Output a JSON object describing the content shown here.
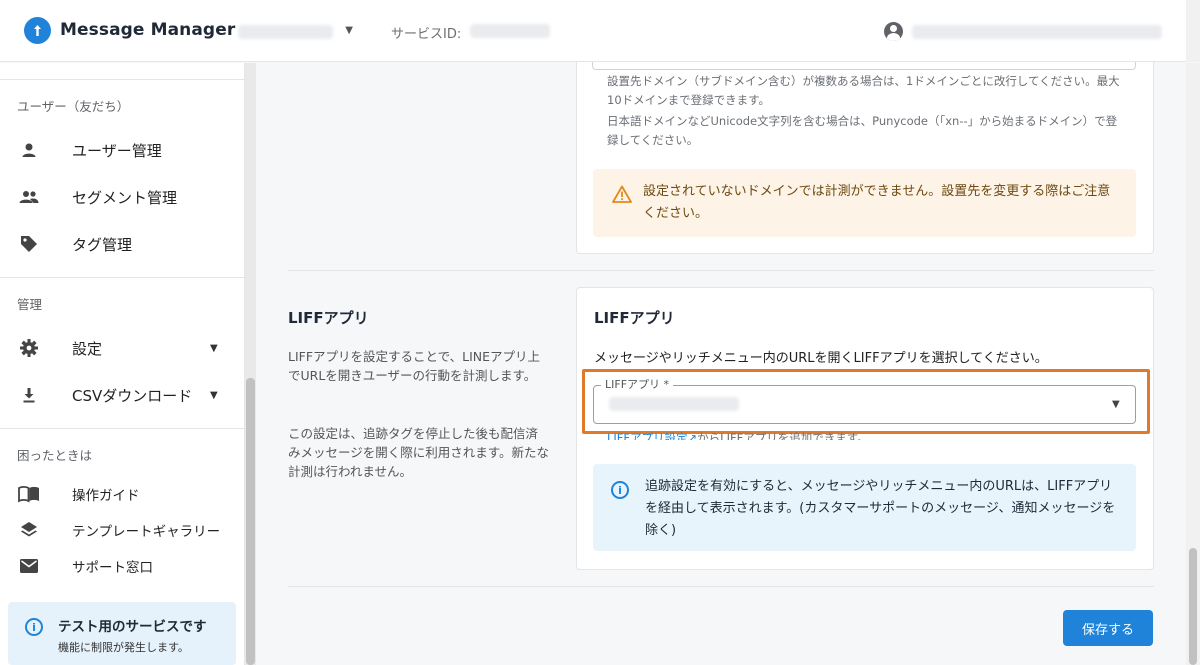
{
  "header": {
    "app_title": "Message Manager",
    "service_label": "サービスID:"
  },
  "sidebar": {
    "sections": [
      {
        "title": "ユーザー（友だち）",
        "items": [
          {
            "label": "ユーザー管理",
            "icon": "person-icon"
          },
          {
            "label": "セグメント管理",
            "icon": "group-icon"
          },
          {
            "label": "タグ管理",
            "icon": "tag-icon"
          }
        ]
      },
      {
        "title": "管理",
        "items": [
          {
            "label": "設定",
            "icon": "gear-icon",
            "dropdown": true
          },
          {
            "label": "CSVダウンロード",
            "icon": "download-icon",
            "dropdown": true
          }
        ]
      },
      {
        "title": "困ったときは",
        "items": [
          {
            "label": "操作ガイド",
            "icon": "book-icon"
          },
          {
            "label": "テンプレートギャラリー",
            "icon": "layers-icon"
          },
          {
            "label": "サポート窓口",
            "icon": "mail-icon"
          }
        ]
      }
    ],
    "notice": {
      "title": "テスト用のサービスです",
      "subtitle": "機能に制限が発生します。"
    }
  },
  "domain_card": {
    "help_1": "設置先ドメイン（サブドメイン含む）が複数ある場合は、1ドメインごとに改行してください。最大10ドメインまで登録できます。",
    "help_2": "日本語ドメインなどUnicode文字列を含む場合は、Punycode（「xn--」から始まるドメイン）で登録してください。",
    "warning": "設定されていないドメインでは計測ができません。設置先を変更する際はご注意ください。"
  },
  "liff_section": {
    "title": "LIFFアプリ",
    "desc_1": "LIFFアプリを設定することで、LINEアプリ上でURLを開きユーザーの行動を計測します。",
    "desc_2": "この設定は、追跡タグを停止した後も配信済みメッセージを開く際に利用されます。新たな計測は行われません。",
    "card_title": "LIFFアプリ",
    "card_desc": "メッセージやリッチメニュー内のURLを開くLIFFアプリを選択してください。",
    "select_label": "LIFFアプリ *",
    "link_text": "LIFFアプリ設定",
    "link_suffix": "からLIFFアプリを追加できます。",
    "info": "追跡設定を有効にすると、メッセージやリッチメニュー内のURLは、LIFFアプリを経由して表示されます。(カスタマーサポートのメッセージ、通知メッセージを除く)"
  },
  "actions": {
    "save_label": "保存する"
  },
  "colors": {
    "accent": "#1f84d9",
    "highlight": "#e07a2a",
    "warning_bg": "#fdf3e6",
    "info_bg": "#e8f4fc"
  }
}
